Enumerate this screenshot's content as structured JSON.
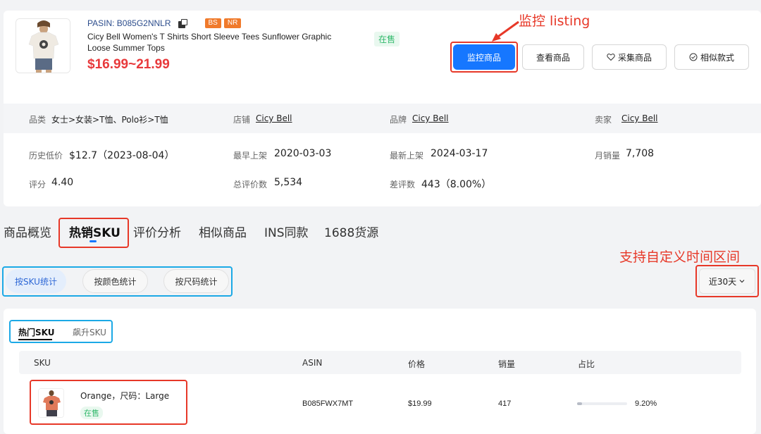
{
  "product": {
    "pasin": "PASIN: B085G2NNLR",
    "badges": [
      "BS",
      "NR"
    ],
    "title": "Cicy Bell Women's T Shirts Short Sleeve Tees Sunflower Graphic Loose Summer Tops",
    "price": "$16.99~21.99",
    "status": "在售"
  },
  "actions": {
    "monitor": "监控商品",
    "view": "查看商品",
    "collect": "采集商品",
    "similar": "相似款式"
  },
  "annotations": {
    "monitor": "监控 listing",
    "custom_range": "支持自定义时间区间"
  },
  "info": {
    "category_label": "品类",
    "category_value": "女士>女装>T恤、Polo衫>T恤",
    "store_label": "店铺",
    "store_value": "Cicy Bell",
    "brand_label": "品牌",
    "brand_value": "Cicy Bell",
    "seller_label": "卖家",
    "seller_value": "Cicy Bell",
    "low_price_label": "历史低价",
    "low_price_value": "$12.7（2023-08-04）",
    "earliest_label": "最早上架",
    "earliest_value": "2020-03-03",
    "latest_label": "最新上架",
    "latest_value": "2024-03-17",
    "monthly_label": "月销量",
    "monthly_value": "7,708",
    "rating_label": "评分",
    "rating_value": "4.40",
    "reviews_label": "总评价数",
    "reviews_value": "5,534",
    "bad_label": "差评数",
    "bad_value": "443（8.00%）"
  },
  "tabs": [
    "商品概览",
    "热销SKU",
    "评价分析",
    "相似商品",
    "INS同款",
    "1688货源"
  ],
  "segments": [
    "按SKU统计",
    "按颜色统计",
    "按尺码统计"
  ],
  "range": "近30天",
  "subtabs": [
    "热门SKU",
    "飙升SKU"
  ],
  "table": {
    "headers": [
      "SKU",
      "ASIN",
      "价格",
      "销量",
      "占比"
    ],
    "rows": [
      {
        "name": "Orange，尺码：Large",
        "status": "在售",
        "asin": "B085FWX7MT",
        "price": "$19.99",
        "sales": "417",
        "share": "9.20%",
        "share_value": 9.2
      }
    ]
  }
}
